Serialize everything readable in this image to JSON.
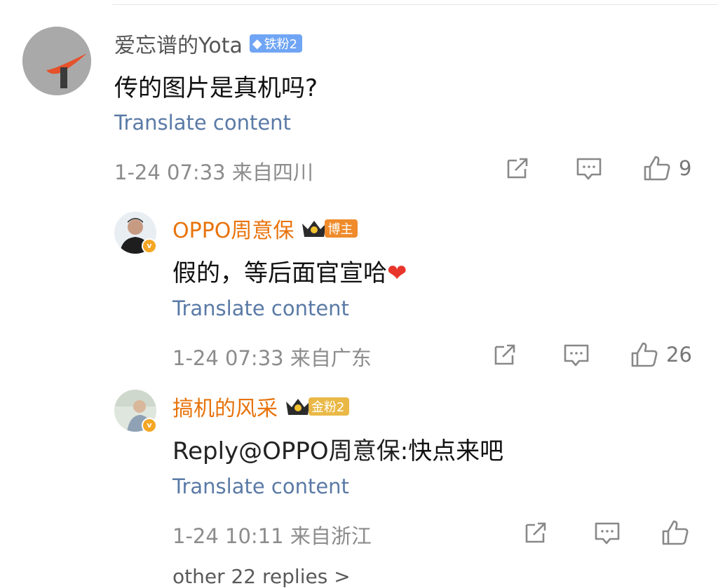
{
  "comments": [
    {
      "username": "爱忘谱的Yota",
      "badge": "铁粉2",
      "text": "传的图片是真机吗?",
      "translate": "Translate content",
      "meta": "1-24 07:33 来自四川",
      "likes": "9"
    },
    {
      "username": "OPPO周意保",
      "badge": "博主",
      "text": "假的，等后面官宣哈",
      "translate": "Translate content",
      "meta": "1-24 07:33 来自广东",
      "likes": "26"
    },
    {
      "username": "搞机的风采",
      "badge": "金粉2",
      "text_prefix": "Reply@OPPO周意保",
      "text_rest": ":快点来吧",
      "translate": "Translate content",
      "meta": "1-24 10:11 来自浙江"
    }
  ],
  "footer": "other 22 replies >",
  "colors": {
    "link_blue": "#5a7aa6",
    "name_orange": "#e8730c",
    "meta_gray": "#8c8c8c"
  },
  "icons": [
    "share-icon",
    "comment-icon",
    "like-icon",
    "heart-emoji",
    "verified-icon",
    "crown-icon"
  ]
}
